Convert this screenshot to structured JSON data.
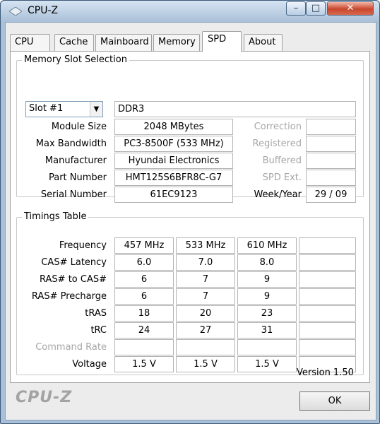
{
  "window": {
    "title": "CPU-Z",
    "minimize_glyph": "–",
    "maximize_glyph": "□",
    "close_glyph": "✕"
  },
  "tabs": [
    {
      "label": "CPU"
    },
    {
      "label": "Cache"
    },
    {
      "label": "Mainboard"
    },
    {
      "label": "Memory"
    },
    {
      "label": "SPD",
      "active": true
    },
    {
      "label": "About"
    }
  ],
  "memory_slot": {
    "group_title": "Memory Slot Selection",
    "slot_value": "Slot #1",
    "memory_type": "DDR3",
    "fields": {
      "module_size": {
        "label": "Module Size",
        "value": "2048 MBytes"
      },
      "max_bandwidth": {
        "label": "Max Bandwidth",
        "value": "PC3-8500F (533 MHz)"
      },
      "manufacturer": {
        "label": "Manufacturer",
        "value": "Hyundai Electronics"
      },
      "part_number": {
        "label": "Part Number",
        "value": "HMT125S6BFR8C-G7"
      },
      "serial_number": {
        "label": "Serial Number",
        "value": "61EC9123"
      }
    },
    "right_fields": {
      "correction": {
        "label": "Correction",
        "value": ""
      },
      "registered": {
        "label": "Registered",
        "value": ""
      },
      "buffered": {
        "label": "Buffered",
        "value": ""
      },
      "spd_ext": {
        "label": "SPD Ext.",
        "value": ""
      },
      "week_year": {
        "label": "Week/Year",
        "value": "29 / 09"
      }
    }
  },
  "timings": {
    "group_title": "Timings Table",
    "rows": [
      {
        "label": "Frequency",
        "values": [
          "457 MHz",
          "533 MHz",
          "610 MHz",
          ""
        ]
      },
      {
        "label": "CAS# Latency",
        "values": [
          "6.0",
          "7.0",
          "8.0",
          ""
        ]
      },
      {
        "label": "RAS# to CAS#",
        "values": [
          "6",
          "7",
          "9",
          ""
        ]
      },
      {
        "label": "RAS# Precharge",
        "values": [
          "6",
          "7",
          "9",
          ""
        ]
      },
      {
        "label": "tRAS",
        "values": [
          "18",
          "20",
          "23",
          ""
        ]
      },
      {
        "label": "tRC",
        "values": [
          "24",
          "27",
          "31",
          ""
        ]
      },
      {
        "label": "Command Rate",
        "values": [
          "",
          "",
          "",
          ""
        ],
        "disabled": true
      },
      {
        "label": "Voltage",
        "values": [
          "1.5 V",
          "1.5 V",
          "1.5 V",
          ""
        ]
      }
    ]
  },
  "footer": {
    "version": "Version 1.50",
    "brand": "CPU-Z",
    "ok_label": "OK"
  }
}
